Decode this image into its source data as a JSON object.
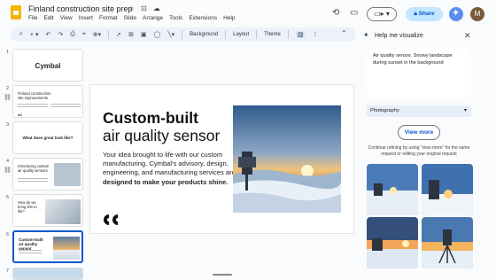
{
  "app": {
    "doc_title": "Finland construction site prep",
    "menu": [
      "File",
      "Edit",
      "View",
      "Insert",
      "Format",
      "Slide",
      "Arrange",
      "Tools",
      "Extensions",
      "Help"
    ],
    "share_label": "Share",
    "avatar_initial": "M"
  },
  "toolbar": {
    "background_label": "Background",
    "layout_label": "Layout",
    "theme_label": "Theme"
  },
  "filmstrip": [
    {
      "num": "1",
      "title": "Cymbal"
    },
    {
      "num": "2",
      "title": "Finland construction site improvements"
    },
    {
      "num": "3",
      "title": "What does great look like?"
    },
    {
      "num": "4",
      "title": "Introducing custom air quality sensors"
    },
    {
      "num": "5",
      "title": "How do we bring this to life?"
    },
    {
      "num": "6",
      "title": "Custom-built air quality sensor"
    },
    {
      "num": "7",
      "title": ""
    }
  ],
  "slide": {
    "title": "Custom-built",
    "subtitle": "air quality sensor",
    "body_plain": "Your idea brought to life with our custom manufacturing. Cymbal's advisory, design, engineering, and manufacturing services are ",
    "body_bold": "designed to make your products shine.",
    "logo": "CC"
  },
  "panel": {
    "title": "Help me visualize",
    "prompt": "Air quality sensor. Snowy landscape during sunset in the background",
    "style_selected": "Photography",
    "view_more_label": "View more",
    "hint": "Continue refining by using \"view more\" for the same request or editing your original request"
  },
  "colors": {
    "accent": "#0b57d0",
    "share_bg": "#c2e7ff",
    "selected_border": "#0b57d0"
  }
}
